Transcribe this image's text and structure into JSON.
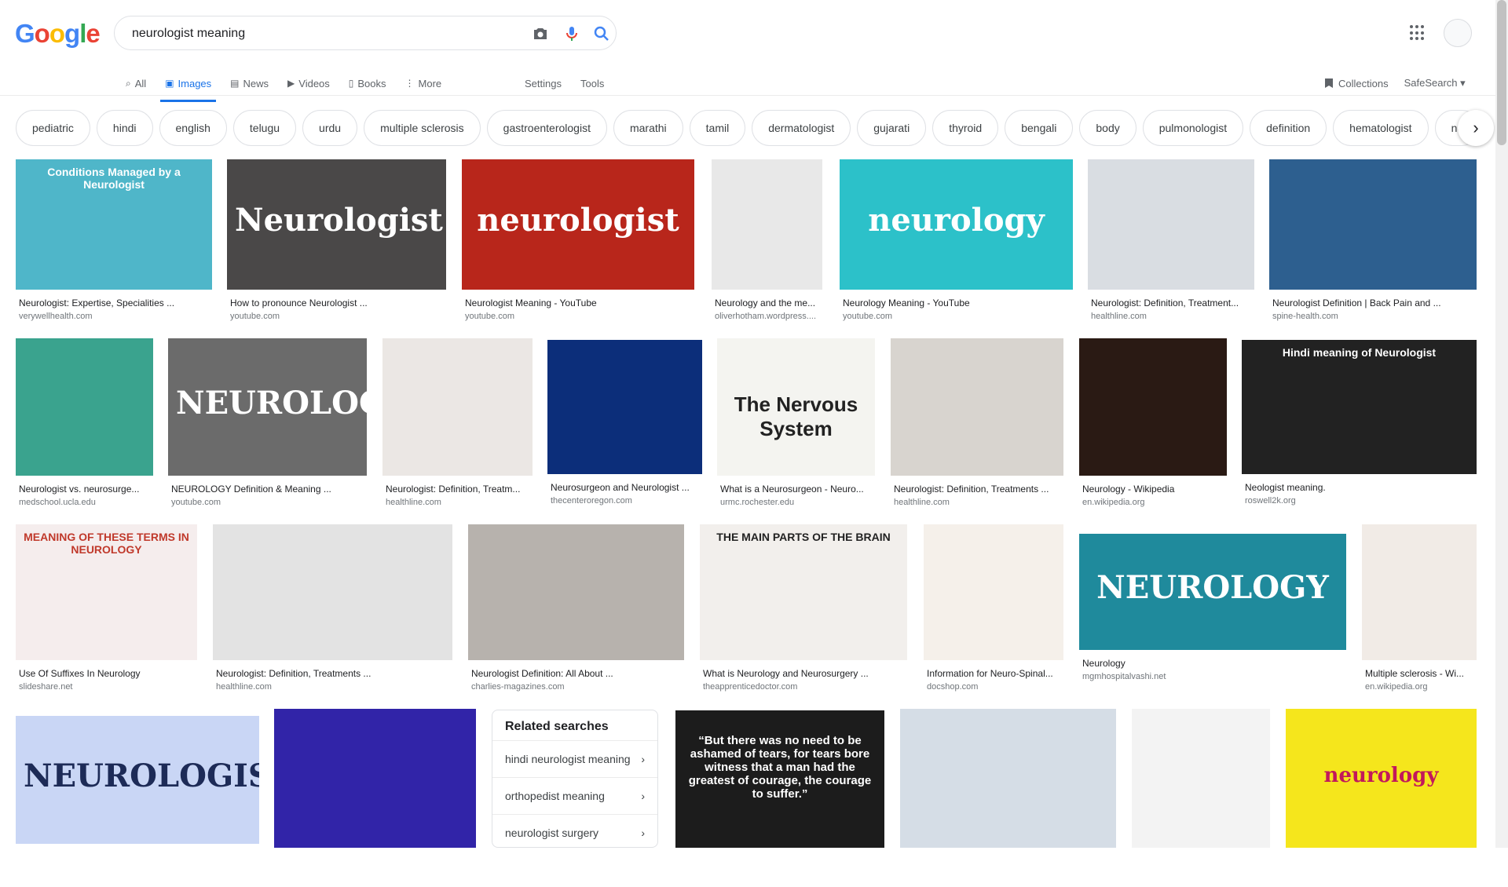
{
  "header": {
    "logo_letters": [
      {
        "ch": "G",
        "color": "#4285f4"
      },
      {
        "ch": "o",
        "color": "#ea4335"
      },
      {
        "ch": "o",
        "color": "#fbbc05"
      },
      {
        "ch": "g",
        "color": "#4285f4"
      },
      {
        "ch": "l",
        "color": "#34a853"
      },
      {
        "ch": "e",
        "color": "#ea4335"
      }
    ],
    "query": "neurologist meaning"
  },
  "tabs": [
    {
      "label": "All",
      "icon": "search-icon"
    },
    {
      "label": "Images",
      "icon": "image-icon",
      "active": true
    },
    {
      "label": "News",
      "icon": "news-icon"
    },
    {
      "label": "Videos",
      "icon": "video-icon"
    },
    {
      "label": "Books",
      "icon": "book-icon"
    },
    {
      "label": "More",
      "icon": "more-vert-icon"
    }
  ],
  "tools": {
    "settings": "Settings",
    "tools": "Tools"
  },
  "right": {
    "collections": "Collections",
    "safesearch": "SafeSearch"
  },
  "chips": [
    "pediatric",
    "hindi",
    "english",
    "telugu",
    "urdu",
    "multiple sclerosis",
    "gastroenterologist",
    "marathi",
    "tamil",
    "dermatologist",
    "gujarati",
    "thyroid",
    "bengali",
    "body",
    "pulmonologist",
    "definition",
    "hematologist",
    "ne"
  ],
  "results": [
    {
      "caption": "Neurologist: Expertise, Specialities ...",
      "source": "verywellhealth.com",
      "bg": "#4fb6c9",
      "text": "Conditions Managed by a Neurologist",
      "fg": "#ffffff"
    },
    {
      "caption": "How to pronounce Neurologist ...",
      "source": "youtube.com",
      "bg": "#4a4848",
      "text": "Neurologist",
      "fg": "#ffffff"
    },
    {
      "caption": "Neurologist Meaning - YouTube",
      "source": "youtube.com",
      "bg": "#b8261b",
      "text": "neurologist",
      "fg": "#ffffff"
    },
    {
      "caption": "Neurology and the me...",
      "source": "oliverhotham.wordpress....",
      "bg": "#e8e8e8",
      "text": "",
      "fg": "#333"
    },
    {
      "caption": "Neurology Meaning - YouTube",
      "source": "youtube.com",
      "bg": "#2cc1c9",
      "text": "neurology",
      "fg": "#ffffff"
    },
    {
      "caption": "Neurologist: Definition, Treatment...",
      "source": "healthline.com",
      "bg": "#d9dde2",
      "text": "",
      "fg": "#333"
    },
    {
      "caption": "Neurologist Definition | Back Pain and ...",
      "source": "spine-health.com",
      "bg": "#2d5f8f",
      "text": "",
      "fg": "#fff"
    },
    {
      "caption": "Neurologist vs. neurosurge...",
      "source": "medschool.ucla.edu",
      "bg": "#3aa38e",
      "text": "",
      "fg": "#fff"
    },
    {
      "caption": "NEUROLOGY Definition & Meaning ...",
      "source": "youtube.com",
      "bg": "#6b6b6b",
      "text": "NEUROLOGY",
      "fg": "#ffffff"
    },
    {
      "caption": "Neurologist: Definition, Treatm...",
      "source": "healthline.com",
      "bg": "#ebe7e4",
      "text": "",
      "fg": "#333"
    },
    {
      "caption": "Neurosurgeon and Neurologist ...",
      "source": "thecenteroregon.com",
      "bg": "#0c2e7a",
      "text": "",
      "fg": "#fff"
    },
    {
      "caption": "What is a Neurosurgeon - Neuro...",
      "source": "urmc.rochester.edu",
      "bg": "#f4f4f0",
      "text": "The Nervous System",
      "fg": "#222"
    },
    {
      "caption": "Neurologist: Definition, Treatments ...",
      "source": "healthline.com",
      "bg": "#d8d4cf",
      "text": "",
      "fg": "#333"
    },
    {
      "caption": "Neurology - Wikipedia",
      "source": "en.wikipedia.org",
      "bg": "#2a1a14",
      "text": "",
      "fg": "#fff"
    },
    {
      "caption": "Neologist meaning.",
      "source": "roswell2k.org",
      "bg": "#222222",
      "text": "Hindi meaning of Neurologist",
      "fg": "#ffffff"
    },
    {
      "caption": "Use Of Suffixes In Neurology",
      "source": "slideshare.net",
      "bg": "#f5eded",
      "text": "MEANING OF THESE TERMS IN NEUROLOGY",
      "fg": "#c0392b"
    },
    {
      "caption": "Neurologist: Definition, Treatments ...",
      "source": "healthline.com",
      "bg": "#e3e3e3",
      "text": "",
      "fg": "#333"
    },
    {
      "caption": "Neurologist Definition: All About ...",
      "source": "charlies-magazines.com",
      "bg": "#b7b2ad",
      "text": "",
      "fg": "#333"
    },
    {
      "caption": "What is Neurology and Neurosurgery ...",
      "source": "theapprenticedoctor.com",
      "bg": "#f2efec",
      "text": "THE MAIN PARTS OF THE BRAIN",
      "fg": "#222"
    },
    {
      "caption": "Information for Neuro-Spinal...",
      "source": "docshop.com",
      "bg": "#f5f0ea",
      "text": "",
      "fg": "#333"
    },
    {
      "caption": "Neurology",
      "source": "mgmhospitalvashi.net",
      "bg": "#1f8a9c",
      "text": "NEUROLOGY",
      "fg": "#ffffff"
    },
    {
      "caption": "Multiple sclerosis - Wi...",
      "source": "en.wikipedia.org",
      "bg": "#f1ebe6",
      "text": "",
      "fg": "#333"
    },
    {
      "caption": "",
      "source": "",
      "bg": "#c9d6f5",
      "text": "NEUROLOGIST",
      "fg": "#1d2b57"
    },
    {
      "caption": "",
      "source": "",
      "bg": "#3124a8",
      "text": "",
      "fg": "#fff"
    },
    {
      "caption": "",
      "source": "",
      "bg": "#1c1c1c",
      "text": "“But there was no need to be ashamed of tears, for tears bore witness that a man had the greatest of courage, the courage to suffer.”",
      "fg": "#ffffff"
    },
    {
      "caption": "",
      "source": "",
      "bg": "#d5dde6",
      "text": "",
      "fg": "#333"
    },
    {
      "caption": "",
      "source": "",
      "bg": "#f3f3f3",
      "text": "",
      "fg": "#333"
    },
    {
      "caption": "",
      "source": "",
      "bg": "#f5e61c",
      "text": "neurology",
      "fg": "#c2185b"
    }
  ],
  "related": {
    "title": "Related searches",
    "items": [
      "hindi neurologist meaning",
      "orthopedist meaning",
      "neurologist surgery"
    ]
  }
}
